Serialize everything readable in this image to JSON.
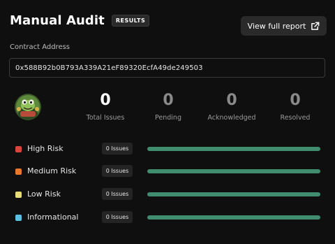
{
  "header": {
    "title": "Manual Audit",
    "badge": "RESULTS",
    "report_button": "View full report"
  },
  "contract": {
    "label": "Contract Address",
    "address": "0x588B92b0B793A339A21eF89320EcfA49de249503"
  },
  "stats": [
    {
      "value": "0",
      "label": "Total Issues"
    },
    {
      "value": "0",
      "label": "Pending"
    },
    {
      "value": "0",
      "label": "Acknowledged"
    },
    {
      "value": "0",
      "label": "Resolved"
    }
  ],
  "risks": [
    {
      "label": "High Risk",
      "badge": "0 Issues",
      "color": "#d9453c"
    },
    {
      "label": "Medium Risk",
      "badge": "0 Issues",
      "color": "#e8762c"
    },
    {
      "label": "Low Risk",
      "badge": "0 Issues",
      "color": "#e6dc7a"
    },
    {
      "label": "Informational",
      "badge": "0 Issues",
      "color": "#5bbfe0"
    }
  ],
  "colors": {
    "bar": "#3f8c6e",
    "background": "#0f0f0f"
  },
  "icons": {
    "report": "external-link-icon",
    "avatar": "frog-avatar-icon"
  }
}
